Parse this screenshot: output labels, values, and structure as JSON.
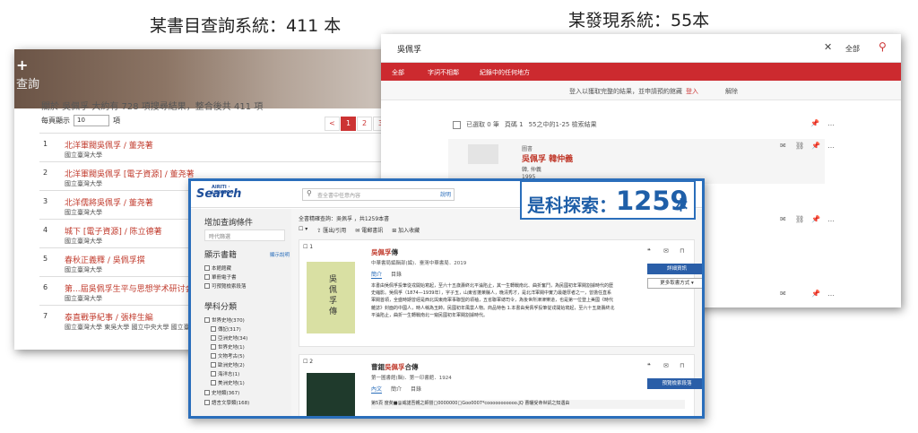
{
  "captions": {
    "left": "某書目查詢系統：411 本",
    "right": "某發現系統：55本"
  },
  "badge": {
    "prefix": "是科探索：",
    "count": "1259",
    "suffix": "本"
  },
  "catalog": {
    "header_line1": "+",
    "header_line2": "查詢",
    "summary": "關於 吳佩孚 大約有 728 項搜尋結果，整合後共 411 項",
    "per_page_label": "每頁顯示",
    "per_page_value": "10",
    "per_page_unit": "項",
    "pages": [
      "<",
      "1",
      "2",
      "3"
    ],
    "rows": [
      {
        "n": "1",
        "title": "北洋軍閥吳佩孚 / 董尧著",
        "sub": "國立臺灣大學"
      },
      {
        "n": "2",
        "title": "北洋軍閥吳佩孚 [電子資源] / 董尧著",
        "sub": "國立臺灣大學"
      },
      {
        "n": "3",
        "title": "北洋儒將吳佩孚 / 董尧著",
        "sub": "國立臺灣大學"
      },
      {
        "n": "4",
        "title": "城下 [電子資源] / 陈立德著",
        "sub": "國立臺灣大學"
      },
      {
        "n": "5",
        "title": "春秋正義釋 / 吳佩孚撰",
        "sub": "國立臺灣大學"
      },
      {
        "n": "6",
        "title": "第...屆吳佩孚生平与思想学术研讨会论",
        "sub": "國立臺灣大學"
      },
      {
        "n": "7",
        "title": "泰直戰爭紀事 / 張梓生編",
        "sub": "國立臺灣大學    東吳大學    國立中央大學    國立臺北大學"
      }
    ]
  },
  "discovery": {
    "query": "吳佩孚",
    "clear": "✕",
    "scope": "全部",
    "search_icon": "⚲",
    "bar_items": [
      "全部",
      "字詞不相鄰",
      "紀錄中的任何地方"
    ],
    "notice": "登入以獲取完整的結果，並申請預約館藏",
    "login": "登入",
    "dismiss": "解除",
    "selected": "已選取 0 筆",
    "page": "頁碼 1",
    "range": "55之中的1-25 檢索結果",
    "result": {
      "type": "圖書",
      "title": "吳佩孚 韓仲義",
      "author": "韓, 仲義",
      "year": "1995"
    }
  },
  "search": {
    "logo": "Search",
    "logo_small": "AIRITI · LINKSCO",
    "placeholder": "查全書中任意內容",
    "help": "說明",
    "sidebar": {
      "add": "增加查詢條件",
      "time": "時代篩選",
      "show": "顯示書籍",
      "show_help": "顯示說明",
      "show_items": [
        "本館館藏",
        "單冊電子書",
        "可預覽檢索段落"
      ],
      "subject": "學科分類",
      "subject_items": [
        "世界史地(370)",
        "傳記(317)",
        "亞洲史地(34)",
        "世界史地(1)",
        "文物考古(5)",
        "歐洲史地(2)",
        "海洋志(1)",
        "美洲史地(1)",
        "史地類(367)",
        "語言文學類(168)"
      ]
    },
    "stat": "全書精確查詢：吳佩孚 ，共1259本書",
    "tools": [
      "匯出/引用",
      "電郵書訊",
      "加入收藏"
    ],
    "r1": {
      "n": "1",
      "title": "吳佩孚傳",
      "pub": "中華書局編輯部(編)．臺灣中華書局．2019",
      "tabs": [
        "簡介",
        "目錄"
      ],
      "desc": "本書由吳佩孚投筆從戎開始寫起，至六十五歲壽終北平淪陷止，其一生轉戰南北、曲折奮鬥，為民國初年軍閥割據時代的歷史縮影。吳佩孚（1874—1939年），字子玉，山東省蓬萊縣人，晚清秀才，是北洋軍閥中實力最雄厚者之一，曾擔任直系軍閥首領，全盛時期曾經是西北與東南軍事聯盟的領袖，五省聯軍總司令，為後世所津津樂道，也是第一位登上美國《時代雜誌》封面的中國人，時人稱為玉帥。民國初年風雲人物。商品特色 1.本書由吳佩孚投筆從戎開始寫起，至六十五歲壽終北平淪陷止，曲折一生轉戰南北一窺民國初年軍閥割據時代。",
      "btn": "詳細資訊",
      "more": "更多取書方式 ▾",
      "cover": "吳佩孚傳"
    },
    "r2": {
      "n": "2",
      "title": "曹錕吳佩孚合傳",
      "pub": "第一圖書館(輯)．第一印書館．1924",
      "tabs": [
        "內文",
        "簡介",
        "目錄"
      ],
      "btn": "預覽檢索段落",
      "snip": "第5頁  度矣■@威諾吾親之師營□0000000□Goo0007*cooooooooooo.JQ 曹曬受命世凱之知遇由"
    }
  }
}
